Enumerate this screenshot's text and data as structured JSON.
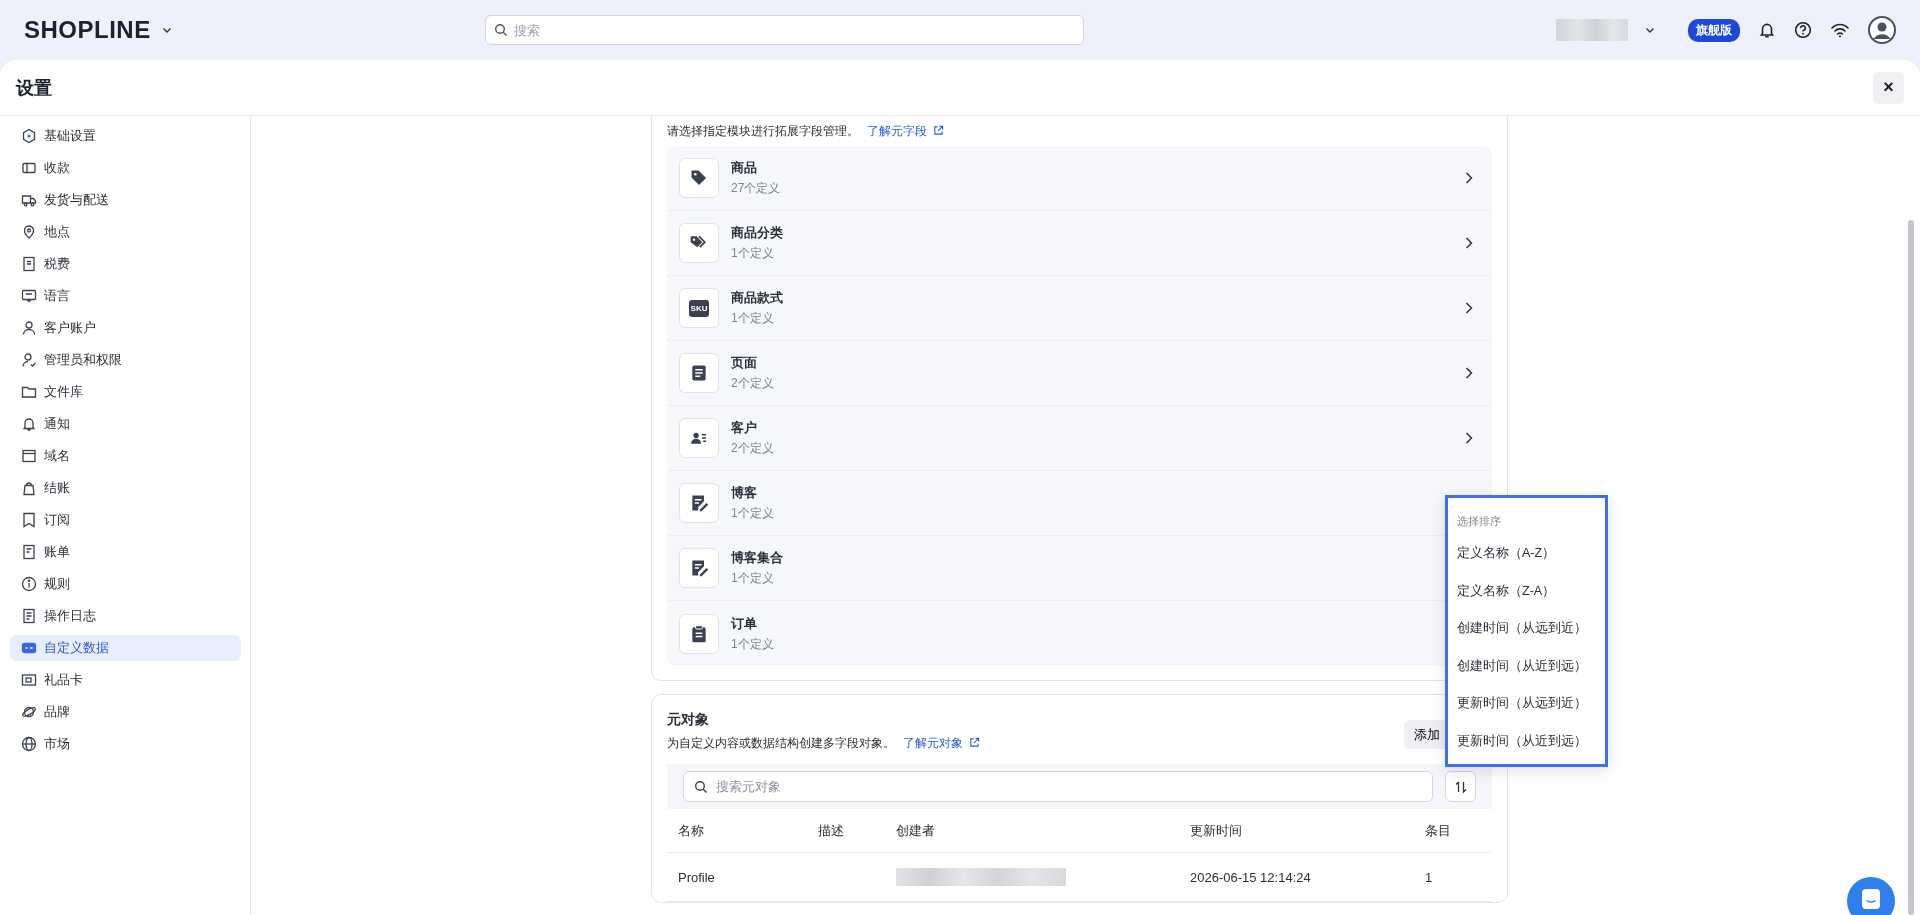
{
  "top_bar": {
    "logo": "SHOPLINE",
    "search": {
      "placeholder": "搜索"
    },
    "plan_badge": "旗舰版"
  },
  "modal": {
    "title": "设置",
    "close": "×"
  },
  "sidebar": {
    "items": [
      {
        "label": "基础设置",
        "selected": false
      },
      {
        "label": "收款",
        "selected": false
      },
      {
        "label": "发货与配送",
        "selected": false
      },
      {
        "label": "地点",
        "selected": false
      },
      {
        "label": "税费",
        "selected": false
      },
      {
        "label": "语言",
        "selected": false
      },
      {
        "label": "客户账户",
        "selected": false
      },
      {
        "label": "管理员和权限",
        "selected": false
      },
      {
        "label": "文件库",
        "selected": false
      },
      {
        "label": "通知",
        "selected": false
      },
      {
        "label": "域名",
        "selected": false
      },
      {
        "label": "结账",
        "selected": false
      },
      {
        "label": "订阅",
        "selected": false
      },
      {
        "label": "账单",
        "selected": false
      },
      {
        "label": "规则",
        "selected": false
      },
      {
        "label": "操作日志",
        "selected": false
      },
      {
        "label": "自定义数据",
        "selected": true
      },
      {
        "label": "礼品卡",
        "selected": false
      },
      {
        "label": "品牌",
        "selected": false
      },
      {
        "label": "市场",
        "selected": false
      }
    ]
  },
  "metafields": {
    "description": "请选择指定模块进行拓展字段管理。",
    "link": "了解元字段",
    "modules": [
      {
        "name": "商品",
        "count": "27个定义",
        "chevron": true
      },
      {
        "name": "商品分类",
        "count": "1个定义",
        "chevron": true
      },
      {
        "name": "商品款式",
        "count": "1个定义",
        "chevron": true,
        "icon_label": "SKU"
      },
      {
        "name": "页面",
        "count": "2个定义",
        "chevron": true
      },
      {
        "name": "客户",
        "count": "2个定义",
        "chevron": true
      },
      {
        "name": "博客",
        "count": "1个定义"
      },
      {
        "name": "博客集合",
        "count": "1个定义"
      },
      {
        "name": "订单",
        "count": "1个定义"
      }
    ]
  },
  "metaobjects": {
    "title": "元对象",
    "description": "为自定义内容或数据结构创建多字段对象。",
    "link": "了解元对象",
    "add_button": "添加",
    "search": {
      "placeholder": "搜索元对象"
    },
    "table": {
      "columns": [
        "名称",
        "描述",
        "创建者",
        "更新时间",
        "条目"
      ],
      "rows": [
        {
          "name": "Profile",
          "updated": "2026-06-15 12:14:24",
          "entries": "1"
        }
      ]
    }
  },
  "sort_menu": {
    "title": "选择排序",
    "options": [
      {
        "label": "定义名称（A-Z）",
        "selected": false
      },
      {
        "label": "定义名称（Z-A）",
        "selected": false
      },
      {
        "label": "创建时间（从远到近）",
        "selected": false
      },
      {
        "label": "创建时间（从近到远）",
        "selected": false
      },
      {
        "label": "更新时间（从远到近）",
        "selected": false
      },
      {
        "label": "更新时间（从近到远）",
        "selected": false
      }
    ]
  }
}
